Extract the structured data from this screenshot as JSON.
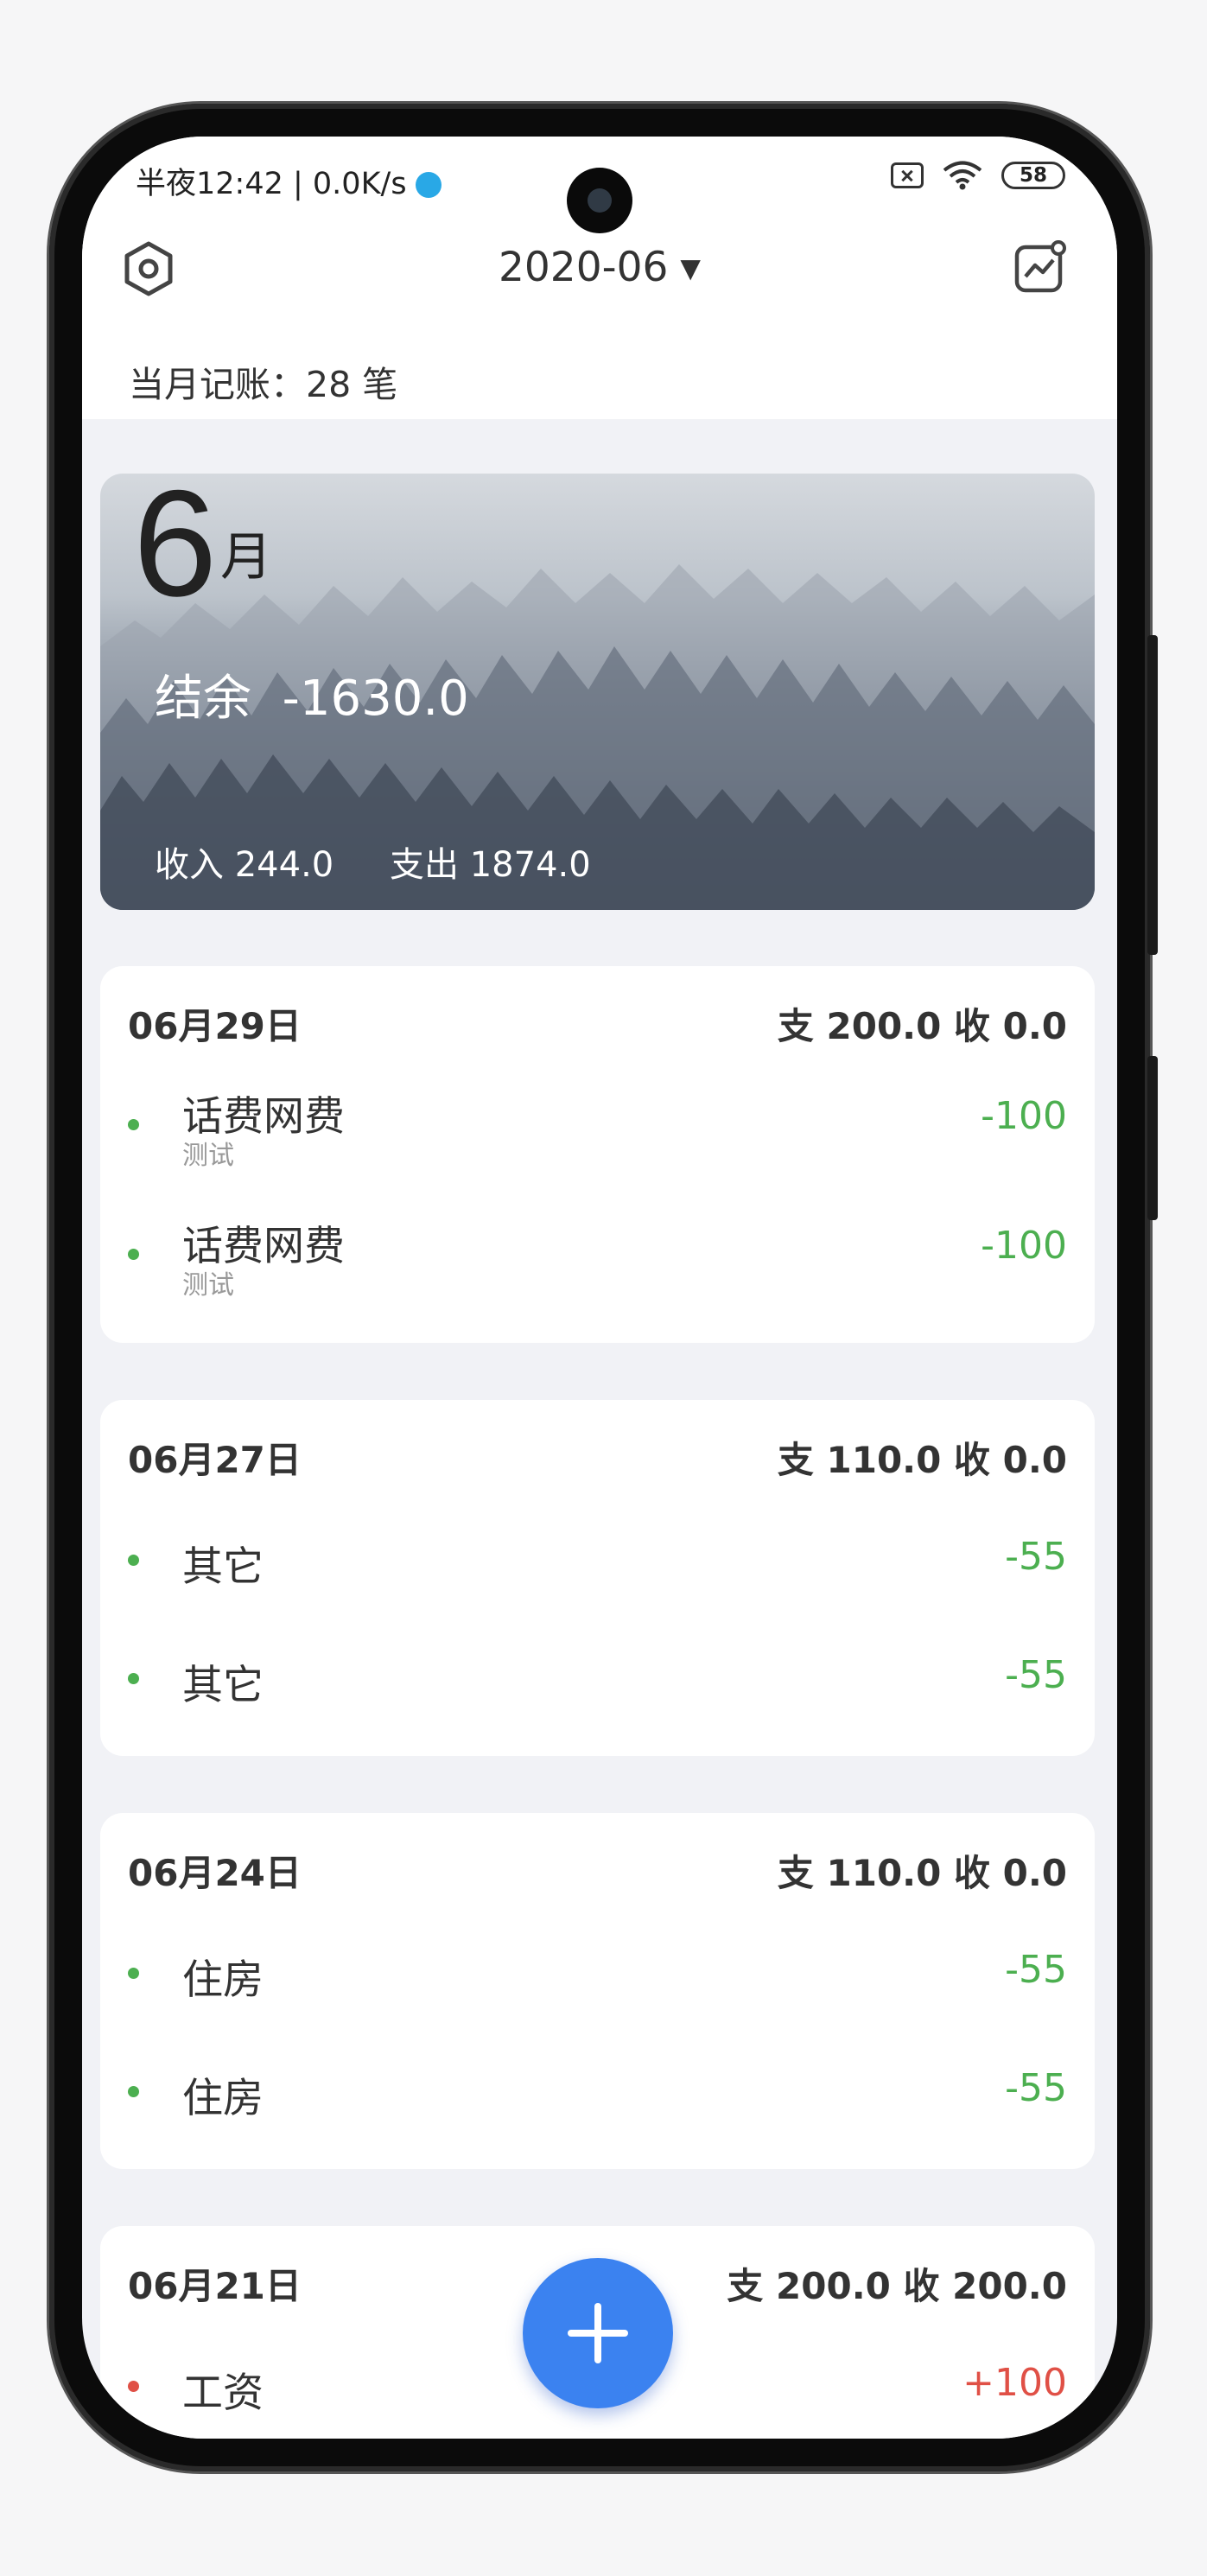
{
  "status_bar": {
    "time_text": "半夜12:42 | 0.0K/s",
    "battery": "58"
  },
  "header": {
    "month": "2020-06",
    "chevron": "▾",
    "left_icon": "settings-hexagon-icon",
    "right_icon": "chart-trend-icon"
  },
  "summary": {
    "count_label": "当月记账：",
    "count_value": "28 笔"
  },
  "banner": {
    "month_number": "6",
    "month_unit": "月",
    "balance_label": "结余",
    "balance_value": "-1630.0",
    "income_label": "收入",
    "income_value": "244.0",
    "expense_label": "支出",
    "expense_value": "1874.0"
  },
  "days": [
    {
      "date": "06月29日",
      "summary": "支 200.0 收 0.0",
      "entries": [
        {
          "name": "话费网费",
          "note": "测试",
          "amount": "-100",
          "type": "expense"
        },
        {
          "name": "话费网费",
          "note": "测试",
          "amount": "-100",
          "type": "expense"
        }
      ]
    },
    {
      "date": "06月27日",
      "summary": "支 110.0 收 0.0",
      "entries": [
        {
          "name": "其它",
          "note": "",
          "amount": "-55",
          "type": "expense"
        },
        {
          "name": "其它",
          "note": "",
          "amount": "-55",
          "type": "expense"
        }
      ]
    },
    {
      "date": "06月24日",
      "summary": "支 110.0 收 0.0",
      "entries": [
        {
          "name": "住房",
          "note": "",
          "amount": "-55",
          "type": "expense"
        },
        {
          "name": "住房",
          "note": "",
          "amount": "-55",
          "type": "expense"
        }
      ]
    },
    {
      "date": "06月21日",
      "summary": "支 200.0 收 200.0",
      "entries": [
        {
          "name": "工资",
          "note": "",
          "amount": "+100",
          "type": "income"
        }
      ]
    }
  ],
  "fab_icon": "plus-icon",
  "colors": {
    "expense": "#4caf50",
    "income": "#e05046",
    "fab": "#3b82f0"
  }
}
